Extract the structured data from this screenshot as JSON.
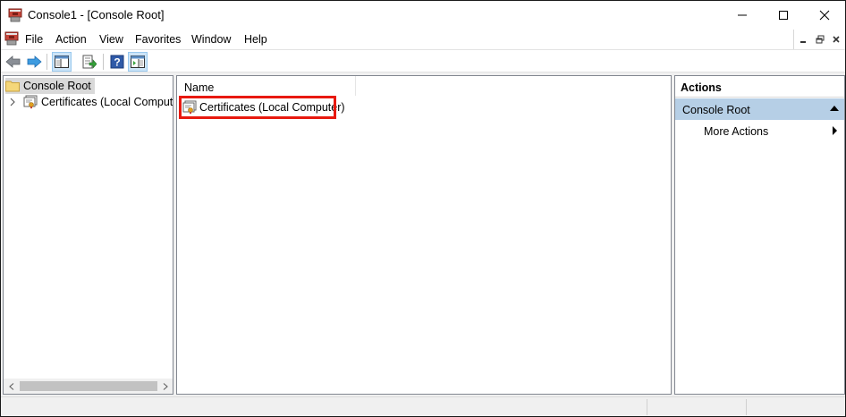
{
  "window": {
    "title": "Console1 - [Console Root]"
  },
  "menu": {
    "items": [
      "File",
      "Action",
      "View",
      "Favorites",
      "Window",
      "Help"
    ]
  },
  "toolbar": {
    "buttons": [
      "back-arrow-icon",
      "forward-arrow-icon",
      "show-hide-console-tree-icon",
      "export-list-icon",
      "help-icon",
      "show-hide-action-pane-icon"
    ]
  },
  "tree": {
    "nodes": [
      {
        "label": "Console Root",
        "selected": true
      },
      {
        "label": "Certificates (Local Computer)",
        "selected": false
      }
    ]
  },
  "results": {
    "column_name": "Name",
    "items": [
      "Certificates (Local Computer)"
    ]
  },
  "actions": {
    "header": "Actions",
    "group": "Console Root",
    "items": [
      "More Actions"
    ]
  },
  "colors": {
    "highlight": "#e8190f",
    "actions_group_bg": "#b6cfe6",
    "tree_selected_bg": "#d9d9d9"
  }
}
